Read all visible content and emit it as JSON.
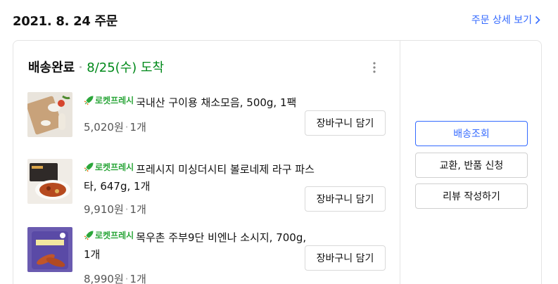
{
  "order": {
    "date_label": "2021. 8. 24 주문",
    "detail_link": "주문 상세 보기"
  },
  "status": {
    "title": "배송완료",
    "arrival": "8/25(수) 도착"
  },
  "badge_label": "로켓프레시",
  "items": [
    {
      "name": "국내산 구이용 채소모음, 500g, 1팩",
      "price": "5,020원",
      "qty": "1개",
      "cart_label": "장바구니 담기"
    },
    {
      "name": "프레시지 미싱더시티 볼로네제 라구 파스타, 647g, 1개",
      "price": "9,910원",
      "qty": "1개",
      "cart_label": "장바구니 담기"
    },
    {
      "name": "목우촌 주부9단 비엔나 소시지, 700g, 1개",
      "price": "8,990원",
      "qty": "1개",
      "cart_label": "장바구니 담기"
    }
  ],
  "actions": {
    "track": "배송조회",
    "exchange": "교환, 반품 신청",
    "review": "리뷰 작성하기"
  },
  "colors": {
    "link": "#346aff",
    "arrival": "#00891a",
    "badge": "#2ba63a"
  },
  "icons": {
    "detail_link": "chevron-right-icon",
    "more": "more-vertical-icon",
    "badge": "rocket-icon"
  }
}
